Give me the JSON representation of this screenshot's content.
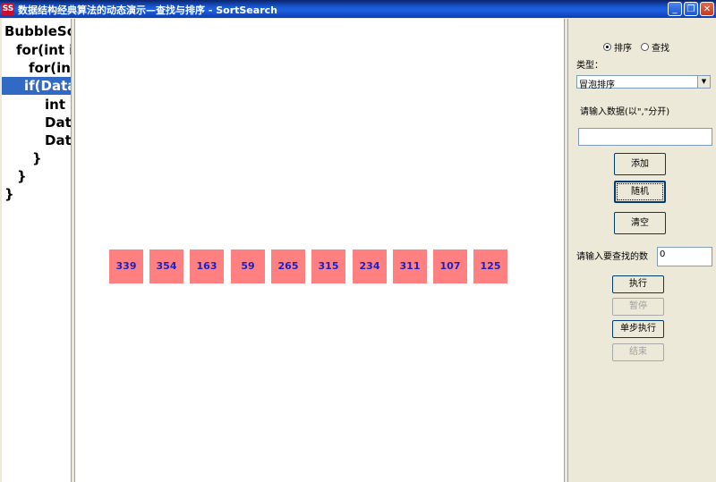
{
  "window": {
    "title": "数据结构经典算法的动态演示—查找与排序 - SortSearch",
    "icon_text": "SS",
    "min_glyph": "_",
    "max_glyph": "❐",
    "close_glyph": "✕"
  },
  "code": {
    "lines": [
      "BubbleSort",
      "  for(int i",
      "    for(int",
      "  if(Data",
      "      int",
      "      Dat",
      "      Dat",
      "    }",
      "  }",
      "}"
    ],
    "highlighted_index": 3
  },
  "array": [
    339,
    354,
    163,
    59,
    265,
    315,
    234,
    311,
    107,
    125
  ],
  "panel": {
    "mode_sort": "排序",
    "mode_search": "查找",
    "type_label": "类型：",
    "type_value": "冒泡排序",
    "input_hint": "请输入数据(以\",\"分开)",
    "input_value": "",
    "add_label": "添加",
    "random_label": "随机",
    "clear_label": "清空",
    "search_label": "请输入要查找的数",
    "search_value": "0",
    "run_label": "执行",
    "pause_label": "暂停",
    "step_label": "单步执行",
    "end_label": "结束"
  }
}
